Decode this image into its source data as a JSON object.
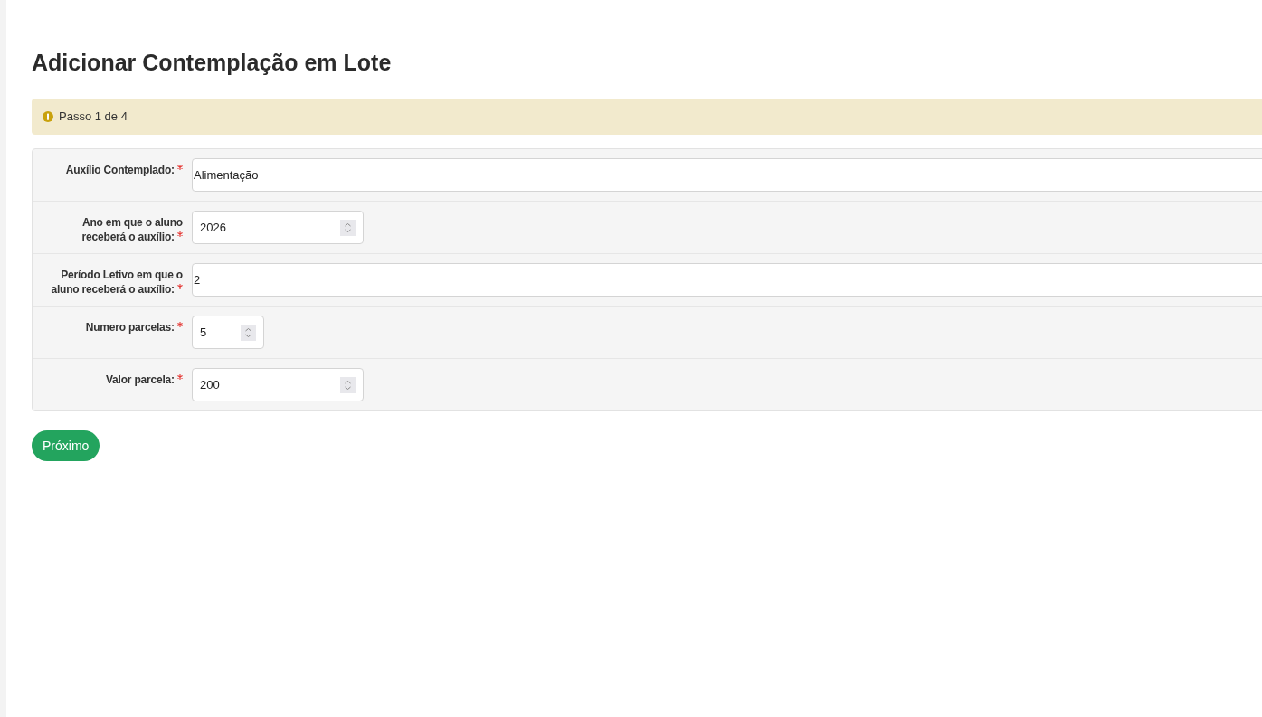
{
  "title": "Adicionar Contemplação em Lote",
  "alert": {
    "text": "Passo 1 de 4"
  },
  "fields": [
    {
      "label": "Auxílio Contemplado:",
      "required": true,
      "kind": "select",
      "value": "Alimentação"
    },
    {
      "label": "Ano em que o aluno receberá o auxílio:",
      "required": true,
      "kind": "number",
      "value": "2026"
    },
    {
      "label": "Período Letivo em que o aluno receberá o auxílio:",
      "required": true,
      "kind": "select",
      "value": "2"
    },
    {
      "label": "Numero parcelas:",
      "required": true,
      "kind": "compact",
      "value": "5"
    },
    {
      "label": "Valor parcela:",
      "required": true,
      "kind": "number",
      "value": "200"
    }
  ],
  "next_button": "Próximo"
}
